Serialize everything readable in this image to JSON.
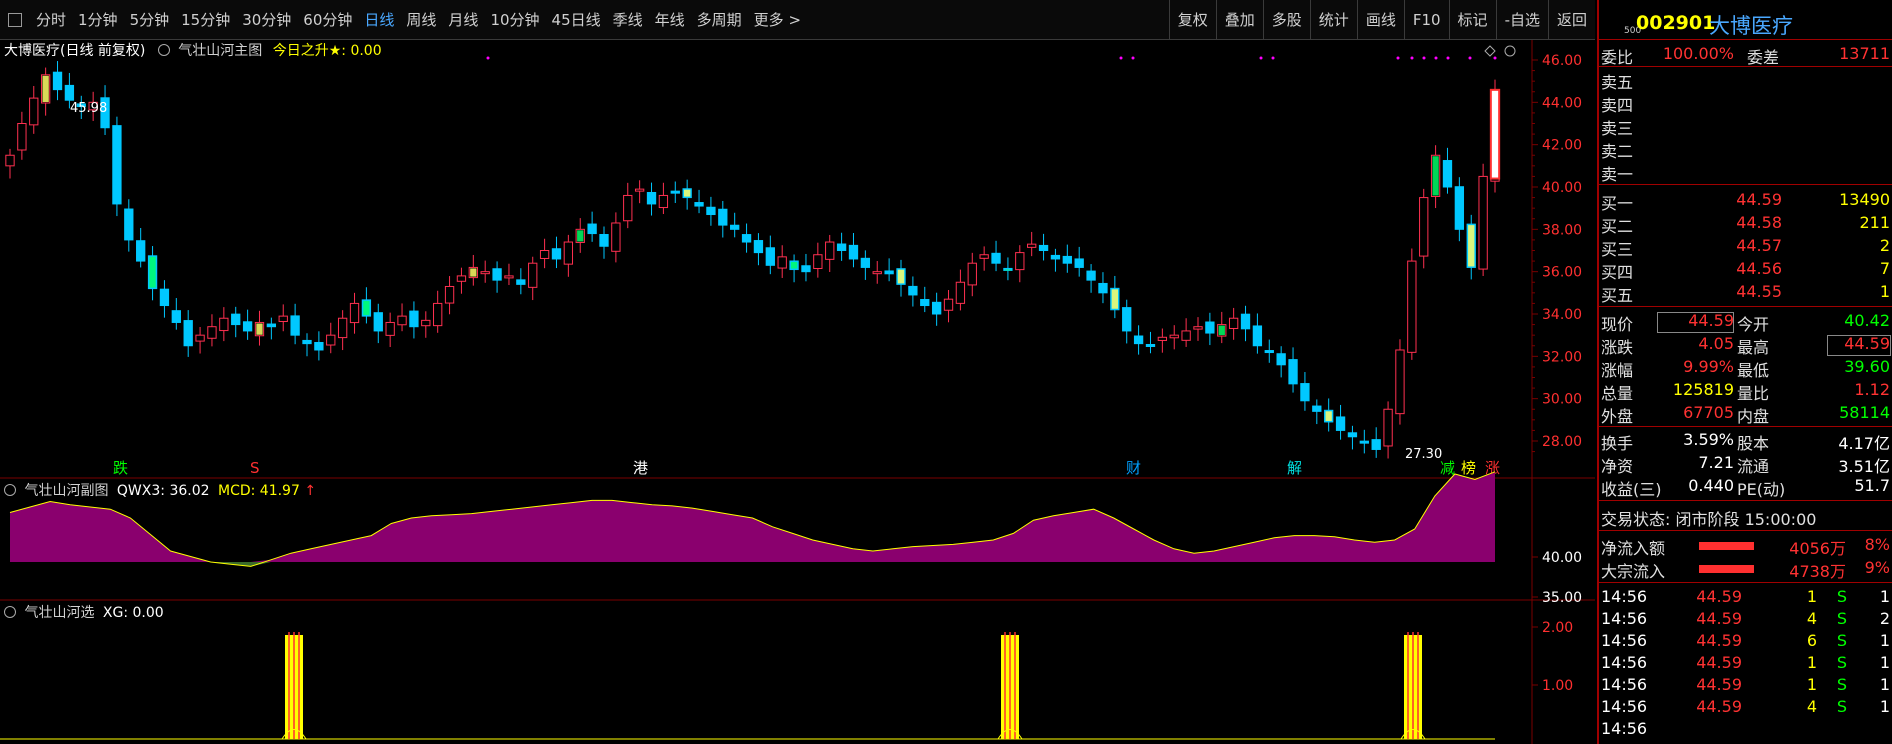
{
  "toolbar": {
    "tabs": [
      "分时",
      "1分钟",
      "5分钟",
      "15分钟",
      "30分钟",
      "60分钟",
      "日线",
      "周线",
      "月线",
      "10分钟",
      "45日线",
      "季线",
      "年线",
      "多周期",
      "更多 >"
    ],
    "active_tab": "日线",
    "tools": [
      "复权",
      "叠加",
      "多股",
      "统计",
      "画线",
      "F10",
      "标记",
      "-自选",
      "返回"
    ]
  },
  "main_pane": {
    "title": "大博医疗(日线 前复权)",
    "indicator": "气壮山河主图",
    "indicator_value": "今日之升★: 0.00",
    "y_ticks": [
      "46.00",
      "44.00",
      "42.00",
      "40.00",
      "38.00",
      "36.00",
      "34.00",
      "32.00",
      "30.00",
      "28.00"
    ],
    "high_label": "45.98",
    "low_label": "27.30",
    "markers": [
      {
        "text": "跌",
        "color": "#00ff00"
      },
      {
        "text": "S",
        "color": "#ff3030"
      },
      {
        "text": "港",
        "color": "#ffffff"
      },
      {
        "text": "财",
        "color": "#00a0ff"
      },
      {
        "text": "解",
        "color": "#00e0e0"
      },
      {
        "text": "减",
        "color": "#00ff00"
      },
      {
        "text": "榜",
        "color": "#ffff00"
      },
      {
        "text": "涨",
        "color": "#ff3030"
      }
    ]
  },
  "sub_pane1": {
    "indicator": "气壮山河副图",
    "label1": "QWX3:",
    "value1": "36.02",
    "label2": "MCD:",
    "value2": "41.97",
    "arrow": "↑",
    "y_ticks": [
      "40.00",
      "35.00"
    ]
  },
  "sub_pane2": {
    "indicator": "气壮山河选",
    "label": "XG:",
    "value": "0.00",
    "y_ticks": [
      "2.00",
      "1.00"
    ]
  },
  "quote": {
    "prefix": "500",
    "code": "002901",
    "name": "大博医疗",
    "weibi_label": "委比",
    "weibi": "100.00%",
    "weicha_label": "委差",
    "weicha": "13711",
    "sell": [
      {
        "label": "卖五",
        "price": "",
        "vol": ""
      },
      {
        "label": "卖四",
        "price": "",
        "vol": ""
      },
      {
        "label": "卖三",
        "price": "",
        "vol": ""
      },
      {
        "label": "卖二",
        "price": "",
        "vol": ""
      },
      {
        "label": "卖一",
        "price": "",
        "vol": ""
      }
    ],
    "buy": [
      {
        "label": "买一",
        "price": "44.59",
        "vol": "13490"
      },
      {
        "label": "买二",
        "price": "44.58",
        "vol": "211"
      },
      {
        "label": "买三",
        "price": "44.57",
        "vol": "2"
      },
      {
        "label": "买四",
        "price": "44.56",
        "vol": "7"
      },
      {
        "label": "买五",
        "price": "44.55",
        "vol": "1"
      }
    ],
    "stats": [
      {
        "l1": "现价",
        "v1": "44.59",
        "c1": "red",
        "l2": "今开",
        "v2": "40.42",
        "c2": "green"
      },
      {
        "l1": "涨跌",
        "v1": "4.05",
        "c1": "red",
        "l2": "最高",
        "v2": "44.59",
        "c2": "red"
      },
      {
        "l1": "涨幅",
        "v1": "9.99%",
        "c1": "red",
        "l2": "最低",
        "v2": "39.60",
        "c2": "green"
      },
      {
        "l1": "总量",
        "v1": "125819",
        "c1": "yellow",
        "l2": "量比",
        "v2": "1.12",
        "c2": "red"
      },
      {
        "l1": "外盘",
        "v1": "67705",
        "c1": "red",
        "l2": "内盘",
        "v2": "58114",
        "c2": "green"
      }
    ],
    "fund": [
      {
        "l1": "换手",
        "v1": "3.59%",
        "l2": "股本",
        "v2": "4.17亿"
      },
      {
        "l1": "净资",
        "v1": "7.21",
        "l2": "流通",
        "v2": "3.51亿"
      },
      {
        "l1": "收益(三)",
        "v1": "0.440",
        "l2": "PE(动)",
        "v2": "51.7"
      }
    ],
    "trade_status": "交易状态: 闭市阶段 15:00:00",
    "flows": [
      {
        "label": "净流入额",
        "value": "4056万",
        "pct": "8%"
      },
      {
        "label": "大宗流入",
        "value": "4738万",
        "pct": "9%"
      }
    ],
    "ticks": [
      {
        "time": "14:56",
        "price": "44.59",
        "vol": "1",
        "side": "S",
        "n": "1"
      },
      {
        "time": "14:56",
        "price": "44.59",
        "vol": "4",
        "side": "S",
        "n": "2"
      },
      {
        "time": "14:56",
        "price": "44.59",
        "vol": "6",
        "side": "S",
        "n": "1"
      },
      {
        "time": "14:56",
        "price": "44.59",
        "vol": "1",
        "side": "S",
        "n": "1"
      },
      {
        "time": "14:56",
        "price": "44.59",
        "vol": "1",
        "side": "S",
        "n": "1"
      },
      {
        "time": "14:56",
        "price": "44.59",
        "vol": "4",
        "side": "S",
        "n": "1"
      },
      {
        "time": "14:56",
        "price": "",
        "vol": "",
        "side": "",
        "n": ""
      }
    ]
  },
  "colors": {
    "up": "#ff3050",
    "down": "#00c8ff",
    "grid": "#7a0000",
    "accent": "#ffff00"
  }
}
